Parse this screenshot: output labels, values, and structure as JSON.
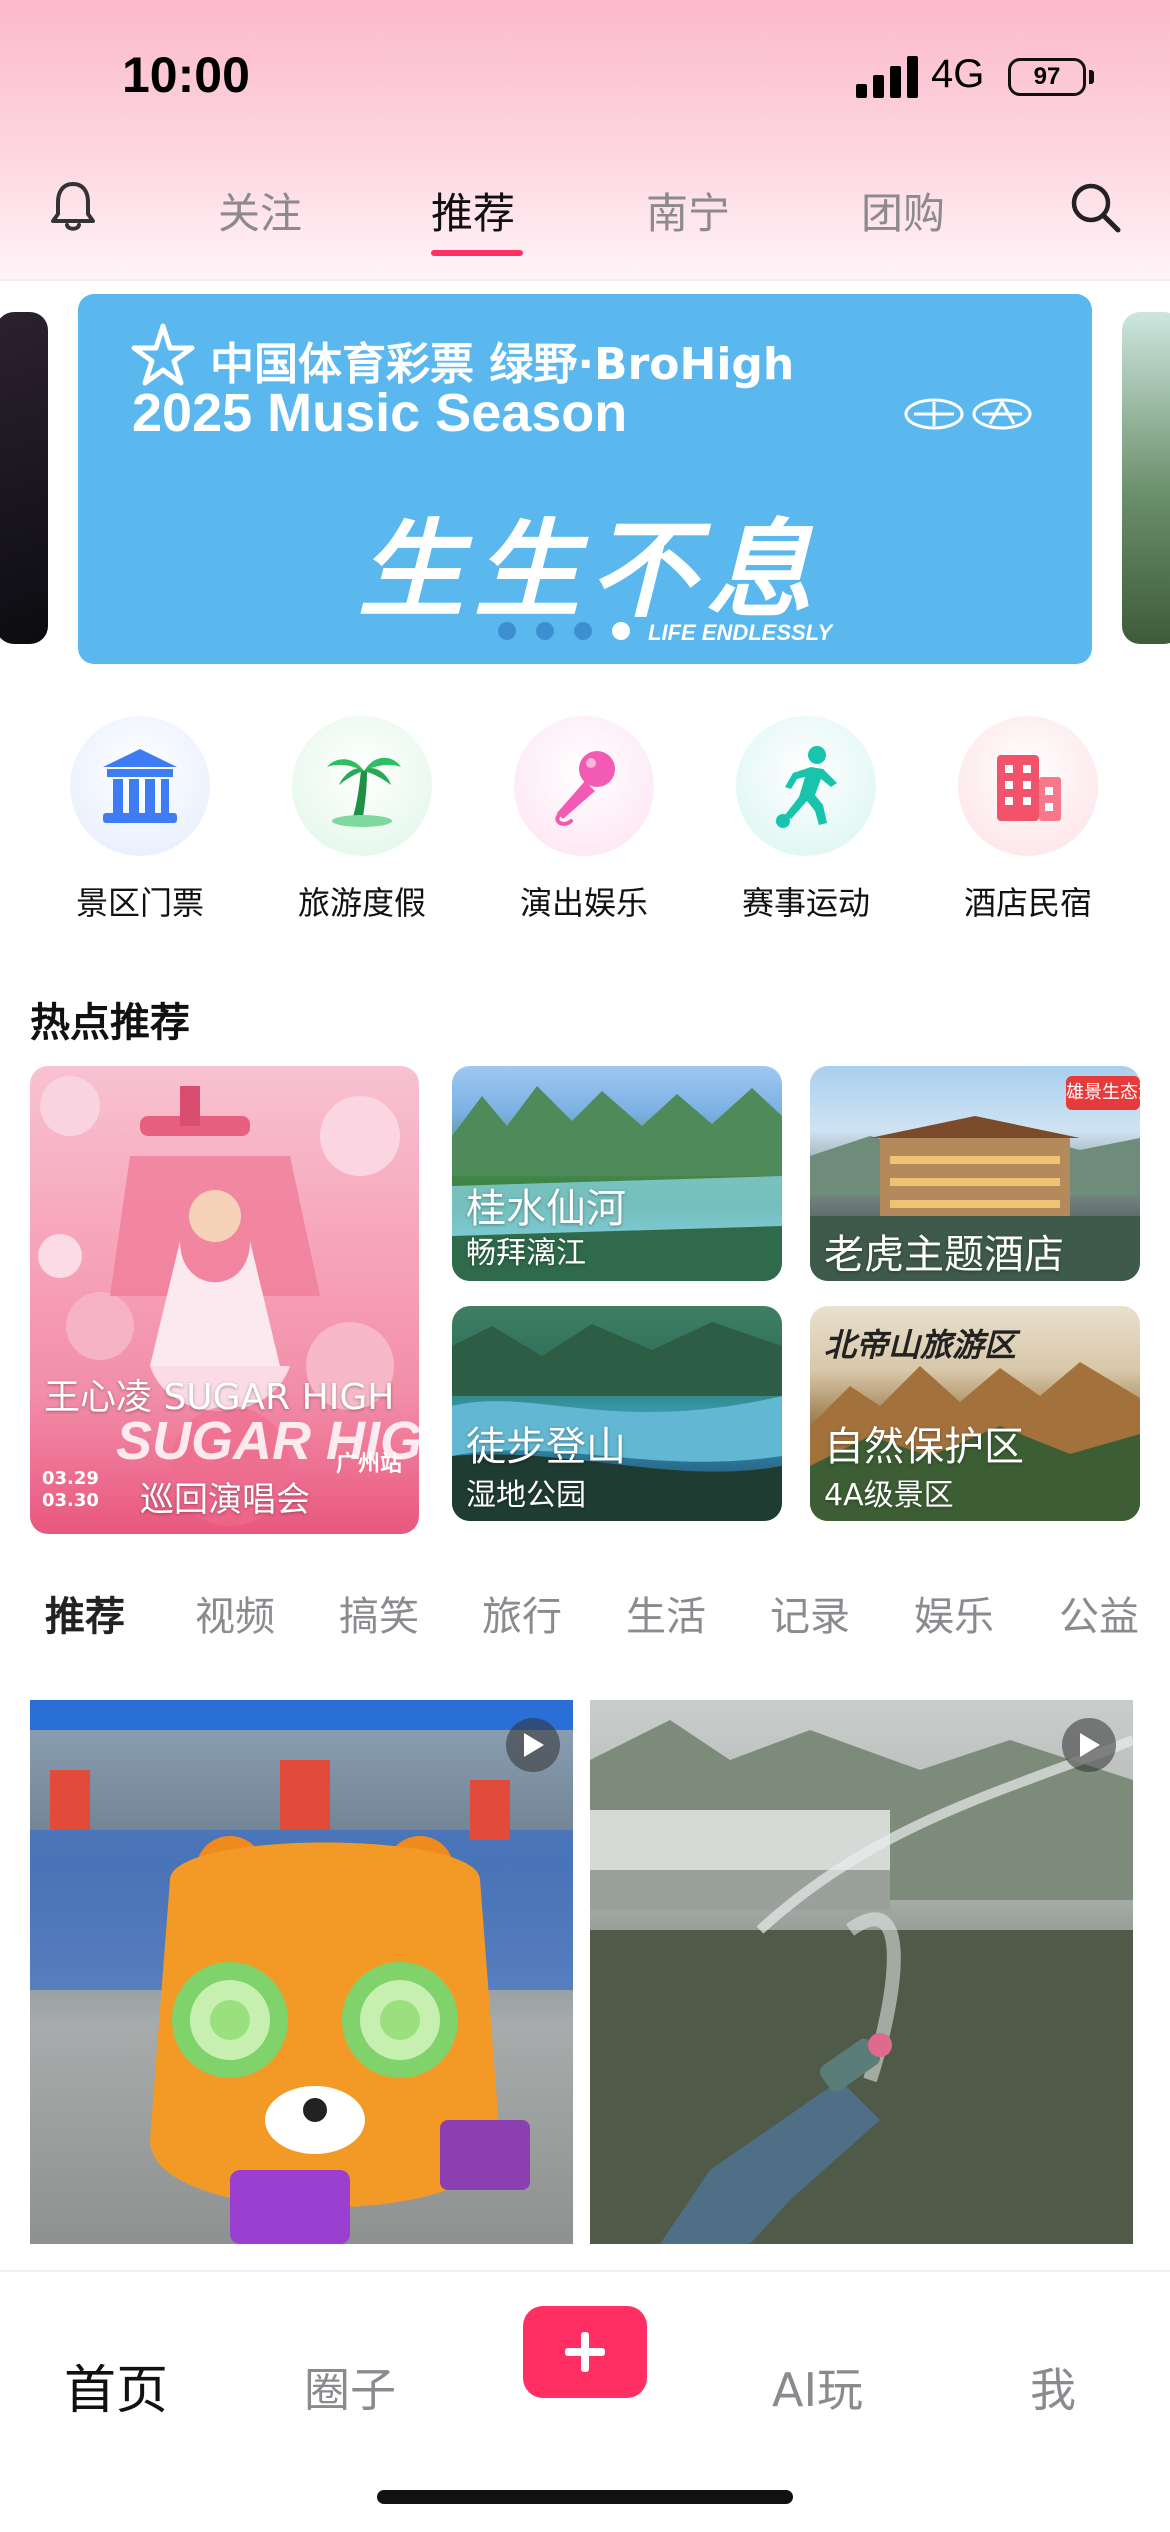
{
  "status_bar": {
    "time": "10:00",
    "network": "4G",
    "battery": "97"
  },
  "top_nav": {
    "tabs": [
      {
        "label": "关注",
        "active": false
      },
      {
        "label": "推荐",
        "active": true
      },
      {
        "label": "南宁",
        "active": false
      },
      {
        "label": "团购",
        "active": false
      }
    ],
    "accent_color": "#ff2e63"
  },
  "banner": {
    "line1": "中国体育彩票  绿野·BroHigh",
    "line2": "2025 Music Season",
    "headline": "生生不息",
    "subline": "LIFE ENDLESSLY",
    "background_color": "#5bb8ee",
    "dots_count": 4,
    "active_dot": 3
  },
  "categories": [
    {
      "label": "景区门票",
      "icon": "temple-icon",
      "color": "#3d7cf2"
    },
    {
      "label": "旅游度假",
      "icon": "palm-tree-icon",
      "color": "#2fbf63"
    },
    {
      "label": "演出娱乐",
      "icon": "microphone-icon",
      "color": "#f25ab4"
    },
    {
      "label": "赛事运动",
      "icon": "runner-icon",
      "color": "#19c4ad"
    },
    {
      "label": "酒店民宿",
      "icon": "hotel-icon",
      "color": "#f2536a"
    }
  ],
  "hot": {
    "title": "热点推荐",
    "featured": {
      "title": "王心凌 SUGAR HIGH",
      "subtitle": "巡回演唱会",
      "poster_text": "SUGAR HIGH",
      "city": "广州站",
      "dates": "03.29 03.30"
    },
    "cards": [
      {
        "title": "桂水仙河",
        "subtitle": "畅拜漓江"
      },
      {
        "title": "老虎主题酒店",
        "subtitle": "",
        "badge": "雄景生态酒"
      },
      {
        "title": "徒步登山",
        "subtitle": "湿地公园"
      },
      {
        "title": "自然保护区",
        "subtitle": "4A级景区",
        "logo_text": "北帝山旅游区"
      }
    ]
  },
  "content_tabs": [
    {
      "label": "推荐",
      "active": true
    },
    {
      "label": "视频",
      "active": false
    },
    {
      "label": "搞笑",
      "active": false
    },
    {
      "label": "旅行",
      "active": false
    },
    {
      "label": "生活",
      "active": false
    },
    {
      "label": "记录",
      "active": false
    },
    {
      "label": "娱乐",
      "active": false
    },
    {
      "label": "公益",
      "active": false
    }
  ],
  "feed": [
    {
      "type": "video",
      "icon": "play-icon"
    },
    {
      "type": "video",
      "icon": "play-icon"
    }
  ],
  "bottom_nav": [
    {
      "label": "首页",
      "active": true
    },
    {
      "label": "圈子",
      "active": false
    },
    {
      "label": "AI玩",
      "active": false
    },
    {
      "label": "我",
      "active": false
    }
  ]
}
